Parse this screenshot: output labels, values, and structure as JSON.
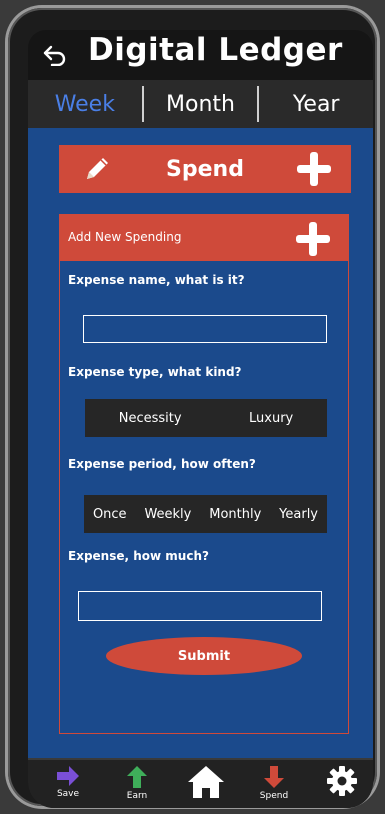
{
  "app": {
    "title": "Digital Ledger"
  },
  "tabs": [
    {
      "label": "Week",
      "active": true
    },
    {
      "label": "Month",
      "active": false
    },
    {
      "label": "Year",
      "active": false
    }
  ],
  "spend_bar": {
    "label": "Spend"
  },
  "card": {
    "title": "Add New Spending",
    "name_question": "Expense name, what is it?",
    "type_question": "Expense type, what kind?",
    "type_options": [
      "Necessity",
      "Luxury"
    ],
    "period_question": "Expense period, how often?",
    "period_options": [
      "Once",
      "Weekly",
      "Monthly",
      "Yearly"
    ],
    "amount_question": "Expense, how much?",
    "submit_label": "Submit"
  },
  "bottom_nav": [
    {
      "label": "Save",
      "icon": "save-arrow-icon",
      "color": "#7a4fd6"
    },
    {
      "label": "Earn",
      "icon": "earn-arrow-icon",
      "color": "#3fae5a"
    },
    {
      "label": "",
      "icon": "home-icon",
      "color": "#ffffff"
    },
    {
      "label": "Spend",
      "icon": "spend-arrow-icon",
      "color": "#cf4a3a"
    },
    {
      "label": "",
      "icon": "gear-icon",
      "color": "#ffffff"
    }
  ],
  "colors": {
    "accent_blue": "#4a7fe6",
    "panel_blue": "#1b4a8c",
    "spend_red": "#cf4a3a"
  }
}
